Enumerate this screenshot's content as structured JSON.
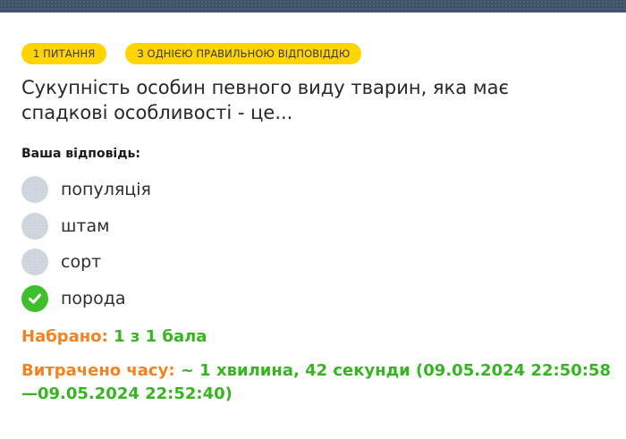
{
  "badges": {
    "question_number": "1 ПИТАННЯ",
    "question_type": "З ОДНІЄЮ ПРАВИЛЬНОЮ ВІДПОВІДДЮ"
  },
  "question": {
    "text": "Сукупність особин певного виду тварин, яка має спадкові особливості - це..."
  },
  "answer_label": "Ваша відповідь:",
  "options": [
    {
      "label": "популяція",
      "state": "unselected"
    },
    {
      "label": "штам",
      "state": "unselected"
    },
    {
      "label": "сорт",
      "state": "unselected"
    },
    {
      "label": "порода",
      "state": "correct",
      "icon": "check-icon"
    }
  ],
  "result": {
    "score_label": "Набрано:",
    "score_value": "1 з 1 бала",
    "time_label": "Витрачено часу:",
    "time_value": "~ 1 хвилина, 42 секунди (09.05.2024 22:50:58—09.05.2024 22:52:40)"
  },
  "colors": {
    "badge": "#ffd400",
    "header_bar": "#3f5468",
    "label_orange": "#f58220",
    "value_green": "#36b521",
    "radio_unselected": "#ccd3dc",
    "radio_correct": "#3fbf2e"
  }
}
